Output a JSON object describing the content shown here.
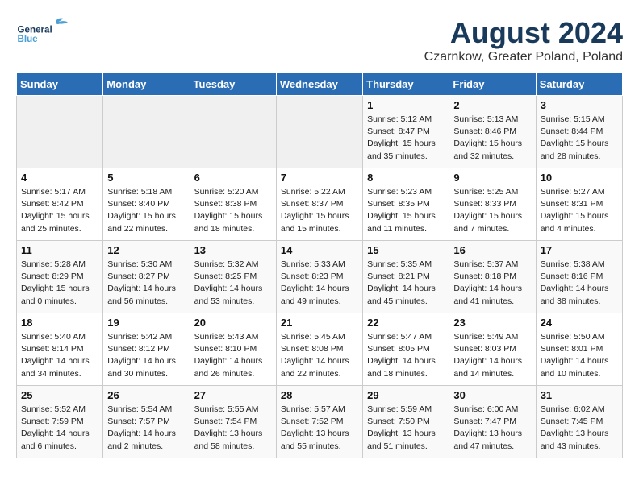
{
  "header": {
    "logo_general": "General",
    "logo_blue": "Blue",
    "main_title": "August 2024",
    "subtitle": "Czarnkow, Greater Poland, Poland"
  },
  "calendar": {
    "headers": [
      "Sunday",
      "Monday",
      "Tuesday",
      "Wednesday",
      "Thursday",
      "Friday",
      "Saturday"
    ],
    "rows": [
      [
        {
          "day": "",
          "info": ""
        },
        {
          "day": "",
          "info": ""
        },
        {
          "day": "",
          "info": ""
        },
        {
          "day": "",
          "info": ""
        },
        {
          "day": "1",
          "info": "Sunrise: 5:12 AM\nSunset: 8:47 PM\nDaylight: 15 hours\nand 35 minutes."
        },
        {
          "day": "2",
          "info": "Sunrise: 5:13 AM\nSunset: 8:46 PM\nDaylight: 15 hours\nand 32 minutes."
        },
        {
          "day": "3",
          "info": "Sunrise: 5:15 AM\nSunset: 8:44 PM\nDaylight: 15 hours\nand 28 minutes."
        }
      ],
      [
        {
          "day": "4",
          "info": "Sunrise: 5:17 AM\nSunset: 8:42 PM\nDaylight: 15 hours\nand 25 minutes."
        },
        {
          "day": "5",
          "info": "Sunrise: 5:18 AM\nSunset: 8:40 PM\nDaylight: 15 hours\nand 22 minutes."
        },
        {
          "day": "6",
          "info": "Sunrise: 5:20 AM\nSunset: 8:38 PM\nDaylight: 15 hours\nand 18 minutes."
        },
        {
          "day": "7",
          "info": "Sunrise: 5:22 AM\nSunset: 8:37 PM\nDaylight: 15 hours\nand 15 minutes."
        },
        {
          "day": "8",
          "info": "Sunrise: 5:23 AM\nSunset: 8:35 PM\nDaylight: 15 hours\nand 11 minutes."
        },
        {
          "day": "9",
          "info": "Sunrise: 5:25 AM\nSunset: 8:33 PM\nDaylight: 15 hours\nand 7 minutes."
        },
        {
          "day": "10",
          "info": "Sunrise: 5:27 AM\nSunset: 8:31 PM\nDaylight: 15 hours\nand 4 minutes."
        }
      ],
      [
        {
          "day": "11",
          "info": "Sunrise: 5:28 AM\nSunset: 8:29 PM\nDaylight: 15 hours\nand 0 minutes."
        },
        {
          "day": "12",
          "info": "Sunrise: 5:30 AM\nSunset: 8:27 PM\nDaylight: 14 hours\nand 56 minutes."
        },
        {
          "day": "13",
          "info": "Sunrise: 5:32 AM\nSunset: 8:25 PM\nDaylight: 14 hours\nand 53 minutes."
        },
        {
          "day": "14",
          "info": "Sunrise: 5:33 AM\nSunset: 8:23 PM\nDaylight: 14 hours\nand 49 minutes."
        },
        {
          "day": "15",
          "info": "Sunrise: 5:35 AM\nSunset: 8:21 PM\nDaylight: 14 hours\nand 45 minutes."
        },
        {
          "day": "16",
          "info": "Sunrise: 5:37 AM\nSunset: 8:18 PM\nDaylight: 14 hours\nand 41 minutes."
        },
        {
          "day": "17",
          "info": "Sunrise: 5:38 AM\nSunset: 8:16 PM\nDaylight: 14 hours\nand 38 minutes."
        }
      ],
      [
        {
          "day": "18",
          "info": "Sunrise: 5:40 AM\nSunset: 8:14 PM\nDaylight: 14 hours\nand 34 minutes."
        },
        {
          "day": "19",
          "info": "Sunrise: 5:42 AM\nSunset: 8:12 PM\nDaylight: 14 hours\nand 30 minutes."
        },
        {
          "day": "20",
          "info": "Sunrise: 5:43 AM\nSunset: 8:10 PM\nDaylight: 14 hours\nand 26 minutes."
        },
        {
          "day": "21",
          "info": "Sunrise: 5:45 AM\nSunset: 8:08 PM\nDaylight: 14 hours\nand 22 minutes."
        },
        {
          "day": "22",
          "info": "Sunrise: 5:47 AM\nSunset: 8:05 PM\nDaylight: 14 hours\nand 18 minutes."
        },
        {
          "day": "23",
          "info": "Sunrise: 5:49 AM\nSunset: 8:03 PM\nDaylight: 14 hours\nand 14 minutes."
        },
        {
          "day": "24",
          "info": "Sunrise: 5:50 AM\nSunset: 8:01 PM\nDaylight: 14 hours\nand 10 minutes."
        }
      ],
      [
        {
          "day": "25",
          "info": "Sunrise: 5:52 AM\nSunset: 7:59 PM\nDaylight: 14 hours\nand 6 minutes."
        },
        {
          "day": "26",
          "info": "Sunrise: 5:54 AM\nSunset: 7:57 PM\nDaylight: 14 hours\nand 2 minutes."
        },
        {
          "day": "27",
          "info": "Sunrise: 5:55 AM\nSunset: 7:54 PM\nDaylight: 13 hours\nand 58 minutes."
        },
        {
          "day": "28",
          "info": "Sunrise: 5:57 AM\nSunset: 7:52 PM\nDaylight: 13 hours\nand 55 minutes."
        },
        {
          "day": "29",
          "info": "Sunrise: 5:59 AM\nSunset: 7:50 PM\nDaylight: 13 hours\nand 51 minutes."
        },
        {
          "day": "30",
          "info": "Sunrise: 6:00 AM\nSunset: 7:47 PM\nDaylight: 13 hours\nand 47 minutes."
        },
        {
          "day": "31",
          "info": "Sunrise: 6:02 AM\nSunset: 7:45 PM\nDaylight: 13 hours\nand 43 minutes."
        }
      ]
    ]
  }
}
